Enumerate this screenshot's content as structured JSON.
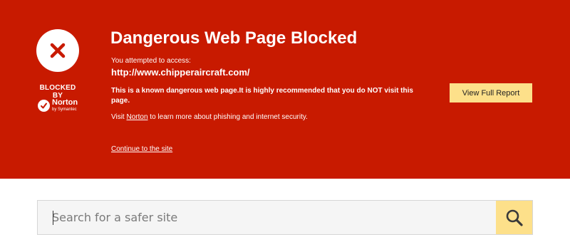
{
  "banner": {
    "title": "Dangerous Web Page Blocked",
    "attempt_label": "You attempted to access:",
    "url": "http://www.chipperaircraft.com/",
    "warning": "This is a known dangerous web page.It is highly recommended that you do NOT visit this page.",
    "visit_prefix": "Visit ",
    "visit_link": "Norton",
    "visit_suffix": " to learn more about phishing and internet security.",
    "continue_link": "Continue to the site",
    "report_button": "View Full Report",
    "blocked_by": "BLOCKED BY",
    "logo_name": "Norton",
    "logo_sub": "by Symantec",
    "status_icon": "x-icon"
  },
  "search": {
    "placeholder": "Search for a safer site",
    "button_icon": "search-icon"
  },
  "colors": {
    "banner_bg": "#c81a00",
    "accent_yellow": "#fde08a",
    "x_color": "#c81a00"
  }
}
